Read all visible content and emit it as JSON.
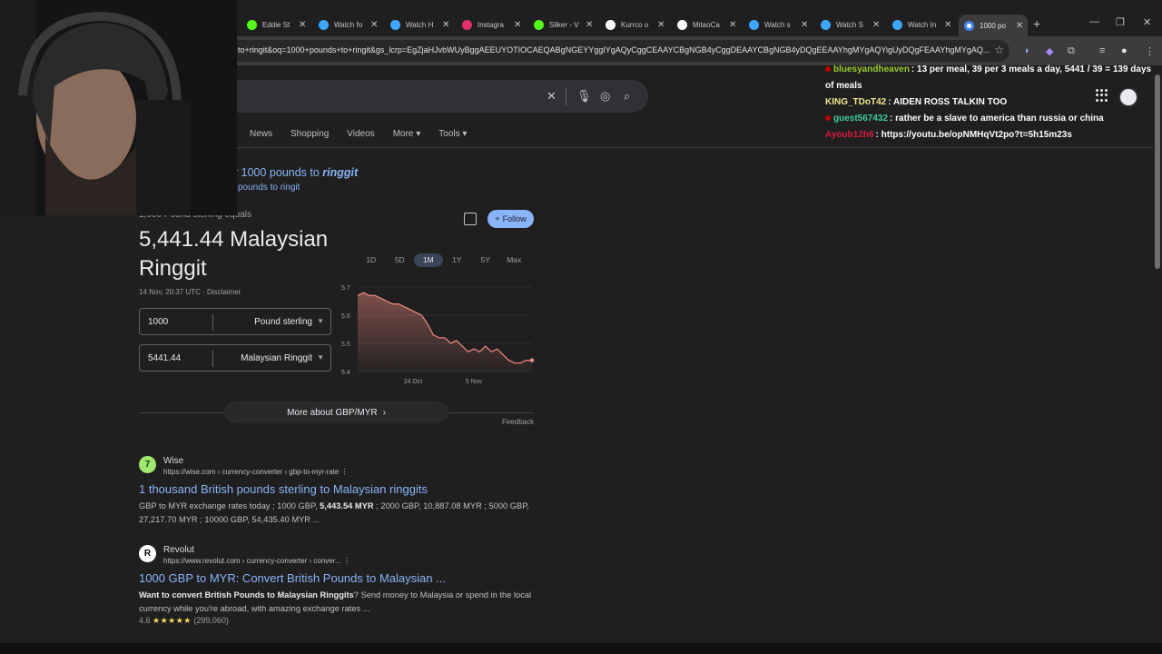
{
  "browser": {
    "tabs": [
      {
        "label": "Eddie St",
        "color": "#53fc18",
        "active": false
      },
      {
        "label": "Watch fo",
        "color": "#3ea6ff",
        "active": false
      },
      {
        "label": "Watch H",
        "color": "#3ea6ff",
        "active": false
      },
      {
        "label": "Instagra",
        "color": "#e1306c",
        "active": false
      },
      {
        "label": "Sliker - V",
        "color": "#53fc18",
        "active": false
      },
      {
        "label": "Kurrco o",
        "color": "#ffffff",
        "active": false
      },
      {
        "label": "MitaoCa",
        "color": "#ffffff",
        "active": false
      },
      {
        "label": "Watch s",
        "color": "#3ea6ff",
        "active": false
      },
      {
        "label": "Watch S",
        "color": "#3ea6ff",
        "active": false
      },
      {
        "label": "Watch In",
        "color": "#3ea6ff",
        "active": false
      },
      {
        "label": "1000 po",
        "color": "#4285f4",
        "active": true
      }
    ],
    "url": "to+ringit&oq=1000+pounds+to+ringit&gs_lcrp=EgZjaHJvbWUyBggAEEUYOTIOCAEQABgNGEYYggIYgAQyCggCEAAYCBgNGB4yCggDEAAYCBgNGB4yDQgEEAAYhgMYgAQYigUyDQgFEAAYhgMYgAQ..."
  },
  "search": {
    "tabs": [
      "News",
      "Shopping",
      "Videos",
      "More",
      "Tools"
    ]
  },
  "suggestion": {
    "prefix": "r 1000 pounds to ",
    "emph": "ringgit",
    "alt": "pounds to ringit"
  },
  "converter": {
    "equals_text": "1,000 Pound sterling equals",
    "result": "5,441.44 Malaysian Ringgit",
    "timestamp": "14 Nov, 20:37 UTC",
    "disclaimer": "Disclaimer",
    "follow_label": "Follow",
    "from_amount": "1000",
    "from_currency": "Pound sterling",
    "to_amount": "5441.44",
    "to_currency": "Malaysian Ringgit",
    "ranges": [
      "1D",
      "5D",
      "1M",
      "1Y",
      "5Y",
      "Max"
    ],
    "active_range": "1M",
    "more_about": "More about GBP/MYR",
    "feedback": "Feedback"
  },
  "chart_data": {
    "type": "area",
    "yticks": [
      "5.7",
      "5.6",
      "5.5",
      "5.4"
    ],
    "ylim": [
      5.4,
      5.7
    ],
    "xticks": [
      "24 Oct",
      "5 Nov"
    ],
    "values": [
      5.67,
      5.68,
      5.67,
      5.67,
      5.66,
      5.65,
      5.64,
      5.64,
      5.63,
      5.62,
      5.61,
      5.6,
      5.57,
      5.53,
      5.52,
      5.52,
      5.5,
      5.51,
      5.49,
      5.47,
      5.48,
      5.47,
      5.49,
      5.47,
      5.48,
      5.46,
      5.44,
      5.43,
      5.43,
      5.44,
      5.44
    ],
    "line_color": "#f28b82"
  },
  "results": [
    {
      "site": "Wise",
      "favicon_color": "#9fe870",
      "favicon_glyph": "7",
      "crumb": "https://wise.com › currency-converter › gbp-to-myr-rate",
      "title": "1 thousand British pounds sterling to Malaysian ringgits",
      "snippet_before": "GBP to MYR exchange rates today ; 1000 GBP, ",
      "snippet_bold": "5,443.54 MYR",
      "snippet_after": " ; 2000 GBP, 10,887.08 MYR ; 5000 GBP, 27,217.70 MYR ; 10000 GBP, 54,435.40 MYR ..."
    },
    {
      "site": "Revolut",
      "favicon_color": "#ffffff",
      "favicon_glyph": "R",
      "crumb": "https://www.revolut.com › currency-converter › conver...",
      "title": "1000 GBP to MYR: Convert British Pounds to Malaysian ...",
      "snippet_bold": "Want to convert British Pounds to Malaysian Ringgits",
      "snippet_after": "? Send money to Malaysia or spend in the local currency while you're abroad, with amazing exchange rates ...",
      "rating": "4.6",
      "rating_count": "(299,060)"
    }
  ],
  "chat": [
    {
      "nick": "bluesyandheaven",
      "nick_color": "#9acd32",
      "text": ": 13 per meal, 39 per 3 meals a day, 5441 / 39 = 139 days of meals"
    },
    {
      "nick": "KING_TDoT42",
      "nick_color": "#f0e68c",
      "text": ": AIDEN ROSS TALKIN TOO"
    },
    {
      "nick": "guest567432",
      "nick_color": "#40c8a0",
      "text": ": rather be a slave to america than russia or china"
    },
    {
      "nick": "Ayoub12h6",
      "nick_color": "#d81b3c",
      "text": ": https://youtu.be/opNMHqVt2po?t=5h15m23s"
    }
  ]
}
